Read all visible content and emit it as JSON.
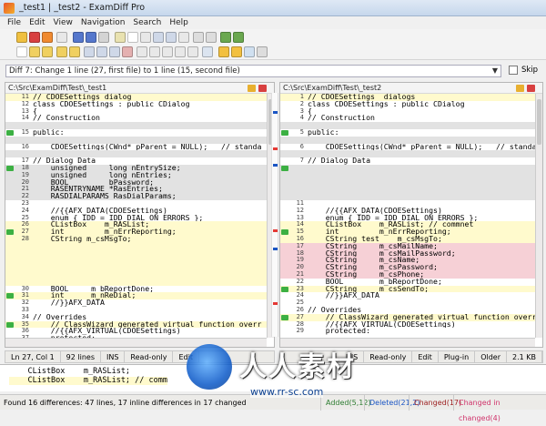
{
  "window": {
    "title": "_test1 | _test2 - ExamDiff Pro"
  },
  "menu": [
    "File",
    "Edit",
    "View",
    "Navigation",
    "Search",
    "Help"
  ],
  "diff_info": {
    "text": "Diff 7: Change 1 line (27, first file) to 1 line (15, second file)",
    "skip_label": "Skip"
  },
  "left": {
    "path": "C:\\Src\\ExamDiff\\Test\\_test1",
    "lines": [
      {
        "n": "11",
        "t": "// CDOESettings dialog",
        "bg": "#fffacd",
        "m": ""
      },
      {
        "n": "12",
        "t": "class CDOESettings : public CDialog",
        "bg": "#fff",
        "m": ""
      },
      {
        "n": "13",
        "t": "{",
        "bg": "#fff",
        "m": ""
      },
      {
        "n": "14",
        "t": "// Construction",
        "bg": "#fff",
        "m": ""
      },
      {
        "n": "",
        "t": "",
        "bg": "#e2e2e2",
        "m": ""
      },
      {
        "n": "15",
        "t": "public:",
        "bg": "#fff",
        "m": "g"
      },
      {
        "n": "",
        "t": "",
        "bg": "#e2e2e2",
        "m": ""
      },
      {
        "n": "16",
        "t": "    CDOESettings(CWnd* pParent = NULL);   // standa",
        "bg": "#fff",
        "m": ""
      },
      {
        "n": "",
        "t": "",
        "bg": "#e2e2e2",
        "m": ""
      },
      {
        "n": "17",
        "t": "// Dialog Data",
        "bg": "#fff",
        "m": ""
      },
      {
        "n": "18",
        "t": "    unsigned     long nEntrySize;",
        "bg": "#e2e2e2",
        "m": "g"
      },
      {
        "n": "19",
        "t": "    unsigned     long nEntries;",
        "bg": "#e2e2e2",
        "m": ""
      },
      {
        "n": "20",
        "t": "    BOOL         bPassword;",
        "bg": "#e2e2e2",
        "m": ""
      },
      {
        "n": "21",
        "t": "    RASENTRYNAME *RasEntries;",
        "bg": "#e2e2e2",
        "m": ""
      },
      {
        "n": "22",
        "t": "    RASDIALPARAMS RasDialParams;",
        "bg": "#e2e2e2",
        "m": ""
      },
      {
        "n": "23",
        "t": "",
        "bg": "#fff",
        "m": ""
      },
      {
        "n": "24",
        "t": "    //{{AFX_DATA(CDOESettings)",
        "bg": "#fff",
        "m": ""
      },
      {
        "n": "25",
        "t": "    enum { IDD = IDD_DIAL_ON_ERRORS };",
        "bg": "#fff",
        "m": ""
      },
      {
        "n": "26",
        "t": "    CListBox    m_RASList;",
        "bg": "#fffacd",
        "m": ""
      },
      {
        "n": "27",
        "t": "    int         m_nErrReporting;",
        "bg": "#fffacd",
        "m": "g"
      },
      {
        "n": "28",
        "t": "    CString m_csMsgTo;",
        "bg": "#fffacd",
        "m": ""
      },
      {
        "n": "",
        "t": "",
        "bg": "#fffacd",
        "m": ""
      },
      {
        "n": "",
        "t": "",
        "bg": "#fffacd",
        "m": ""
      },
      {
        "n": "",
        "t": "",
        "bg": "#fffacd",
        "m": ""
      },
      {
        "n": "",
        "t": "",
        "bg": "#fffacd",
        "m": ""
      },
      {
        "n": "",
        "t": "",
        "bg": "#fffacd",
        "m": ""
      },
      {
        "n": "",
        "t": "",
        "bg": "#fffacd",
        "m": ""
      },
      {
        "n": "30",
        "t": "    BOOL     m_bReportDone;",
        "bg": "#fff",
        "m": ""
      },
      {
        "n": "31",
        "t": "    int      m_nReDial;",
        "bg": "#fffacd",
        "m": "g"
      },
      {
        "n": "32",
        "t": "    //}}AFX_DATA",
        "bg": "#fff",
        "m": ""
      },
      {
        "n": "33",
        "t": "",
        "bg": "#fff",
        "m": ""
      },
      {
        "n": "34",
        "t": "// Overrides",
        "bg": "#fff",
        "m": ""
      },
      {
        "n": "35",
        "t": "    // ClassWizard generated virtual function overr",
        "bg": "#fffacd",
        "m": "g"
      },
      {
        "n": "36",
        "t": "    //{{AFX_VIRTUAL(CDOESettings)",
        "bg": "#fff",
        "m": ""
      },
      {
        "n": "37",
        "t": "    protected:",
        "bg": "#fff",
        "m": ""
      }
    ],
    "status": {
      "pos": "Ln 27, Col 1",
      "lines": "92 lines",
      "mode": "INS",
      "ro": "Read-only",
      "edit": "Edit"
    }
  },
  "right": {
    "path": "C:\\Src\\ExamDiff\\Test\\_test2",
    "lines": [
      {
        "n": "1",
        "t": "// CDOESettings  dialogs",
        "bg": "#fffacd",
        "m": ""
      },
      {
        "n": "2",
        "t": "class CDOESettings : public CDialog",
        "bg": "#fff",
        "m": ""
      },
      {
        "n": "3",
        "t": "{",
        "bg": "#fff",
        "m": ""
      },
      {
        "n": "4",
        "t": "// Construction",
        "bg": "#fff",
        "m": ""
      },
      {
        "n": "",
        "t": "",
        "bg": "#e2e2e2",
        "m": ""
      },
      {
        "n": "5",
        "t": "public:",
        "bg": "#fff",
        "m": "g"
      },
      {
        "n": "",
        "t": "",
        "bg": "#e2e2e2",
        "m": ""
      },
      {
        "n": "6",
        "t": "    CDOESettings(CWnd* pParent = NULL);   // standar",
        "bg": "#fff",
        "m": ""
      },
      {
        "n": "",
        "t": "",
        "bg": "#e2e2e2",
        "m": ""
      },
      {
        "n": "7",
        "t": "// Dialog Data",
        "bg": "#fff",
        "m": ""
      },
      {
        "n": "",
        "t": "",
        "bg": "#e2e2e2",
        "m": "g"
      },
      {
        "n": "",
        "t": "",
        "bg": "#e2e2e2",
        "m": ""
      },
      {
        "n": "",
        "t": "",
        "bg": "#e2e2e2",
        "m": ""
      },
      {
        "n": "",
        "t": "",
        "bg": "#e2e2e2",
        "m": ""
      },
      {
        "n": "",
        "t": "",
        "bg": "#e2e2e2",
        "m": ""
      },
      {
        "n": "11",
        "t": "",
        "bg": "#fff",
        "m": ""
      },
      {
        "n": "12",
        "t": "    //{{AFX_DATA(CDOESettings)",
        "bg": "#fff",
        "m": ""
      },
      {
        "n": "13",
        "t": "    enum { IDD = IDD_DIAL_ON_ERRORS };",
        "bg": "#fff",
        "m": ""
      },
      {
        "n": "14",
        "t": "    CListBox    m_RASList; // commnet",
        "bg": "#fffacd",
        "m": ""
      },
      {
        "n": "15",
        "t": "    int         m_nErrReporting;",
        "bg": "#fffacd",
        "m": "g"
      },
      {
        "n": "16",
        "t": "    CString test    m_csMsgTo;",
        "bg": "#fffacd",
        "m": ""
      },
      {
        "n": "17",
        "t": "    CString     m_csMailName;",
        "bg": "#f6d0d6",
        "m": ""
      },
      {
        "n": "18",
        "t": "    CString     m_csMailPassword;",
        "bg": "#f6d0d6",
        "m": ""
      },
      {
        "n": "19",
        "t": "    CString     m_csName;",
        "bg": "#f6d0d6",
        "m": ""
      },
      {
        "n": "20",
        "t": "    CString     m_csPassword;",
        "bg": "#f6d0d6",
        "m": ""
      },
      {
        "n": "21",
        "t": "    CString     m_csPhone;",
        "bg": "#f6d0d6",
        "m": ""
      },
      {
        "n": "22",
        "t": "    BOOL        m_bReportDone;",
        "bg": "#fff",
        "m": ""
      },
      {
        "n": "23",
        "t": "    CString     m_csSendTo;",
        "bg": "#fffacd",
        "m": "g"
      },
      {
        "n": "24",
        "t": "    //}}AFX_DATA",
        "bg": "#fff",
        "m": ""
      },
      {
        "n": "25",
        "t": "",
        "bg": "#fff",
        "m": ""
      },
      {
        "n": "26",
        "t": "// Overrides",
        "bg": "#fff",
        "m": ""
      },
      {
        "n": "27",
        "t": "    // ClassWizard generated virtual function overri",
        "bg": "#fffacd",
        "m": "g"
      },
      {
        "n": "28",
        "t": "    //{{AFX_VIRTUAL(CDOESettings)",
        "bg": "#fff",
        "m": ""
      },
      {
        "n": "29",
        "t": "    protected:",
        "bg": "#fff",
        "m": ""
      }
    ],
    "status": {
      "mode": "INS",
      "ro": "Read-only",
      "edit": "Edit",
      "plugin": "Plug-in",
      "older": "Older",
      "size": "2.1 KB"
    }
  },
  "bottom": {
    "line1": "    CListBox    m_RASList;",
    "line2": "    CListBox    m_RASList; // comm"
  },
  "footer": {
    "summary": "Found 16 differences: 47 lines, 17 inline differences in 17 changed",
    "added": "Added(5,12)",
    "deleted": "Deleted(21,2)",
    "changed": "Changed(17)",
    "changed_inline": "Changed in changed(4)"
  },
  "watermark": {
    "text": "人人素材",
    "url": "www.rr-sc.com"
  },
  "colors": {
    "added": "#2e7d32",
    "deleted": "#1a55c4",
    "changed": "#9b1c1c",
    "changed_inline": "#d0346b"
  }
}
